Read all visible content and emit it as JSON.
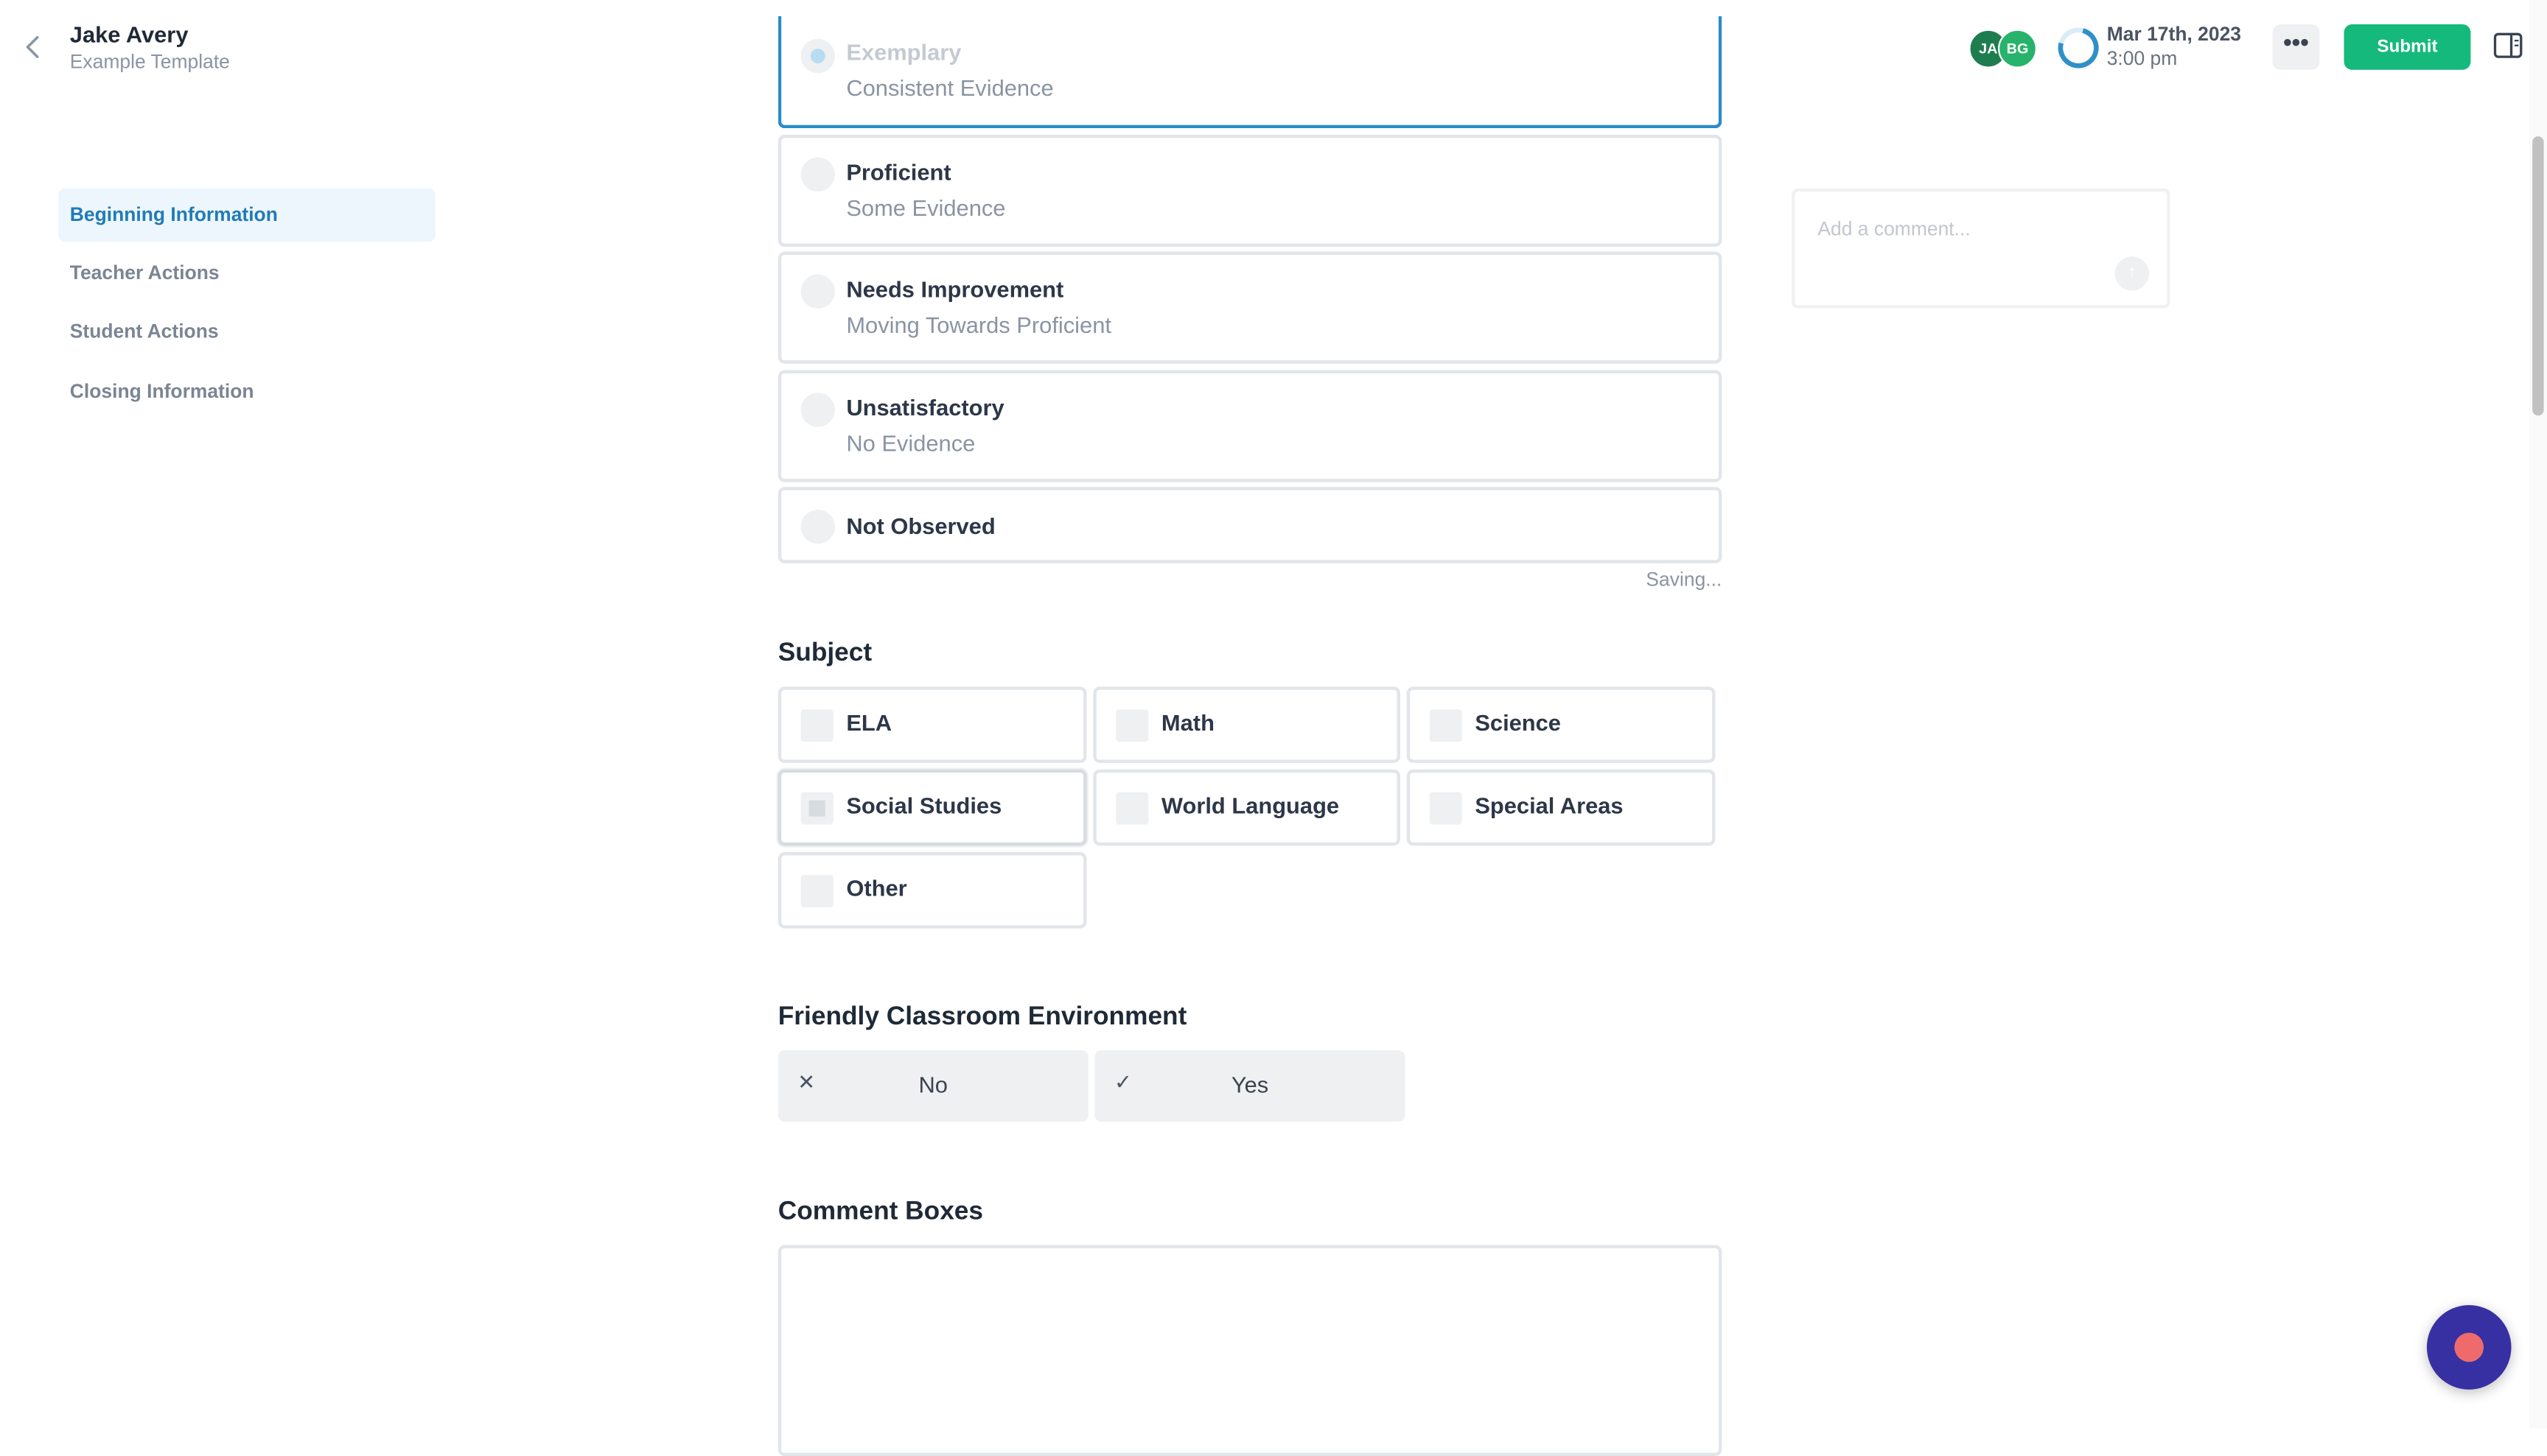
{
  "header": {
    "name": "Jake Avery",
    "template": "Example Template",
    "avatars": [
      "JA",
      "BG"
    ],
    "date": "Mar 17th, 2023",
    "time": "3:00 pm",
    "more_label": "•••",
    "submit_label": "Submit"
  },
  "sidebar": {
    "items": [
      {
        "label": "Beginning Information"
      },
      {
        "label": "Teacher Actions"
      },
      {
        "label": "Student Actions"
      },
      {
        "label": "Closing Information"
      }
    ]
  },
  "rating": {
    "options": [
      {
        "title": "Exemplary",
        "subtitle": "Consistent Evidence"
      },
      {
        "title": "Proficient",
        "subtitle": "Some Evidence"
      },
      {
        "title": "Needs Improvement",
        "subtitle": "Moving Towards Proficient"
      },
      {
        "title": "Unsatisfactory",
        "subtitle": "No Evidence"
      },
      {
        "title": "Not Observed",
        "subtitle": ""
      }
    ],
    "status": "Saving..."
  },
  "subject": {
    "title": "Subject",
    "options": [
      "ELA",
      "Math",
      "Science",
      "Social Studies",
      "World Language",
      "Special Areas",
      "Other"
    ]
  },
  "friendly": {
    "title": "Friendly Classroom Environment",
    "no_label": "No",
    "yes_label": "Yes"
  },
  "comments": {
    "title": "Comment Boxes"
  },
  "side_comment": {
    "placeholder": "Add a comment..."
  },
  "colors": {
    "accent": "#16b97c",
    "selected_border": "#2a8cc7",
    "active_nav": "#1f7cb6",
    "fab": "#3730a3"
  }
}
